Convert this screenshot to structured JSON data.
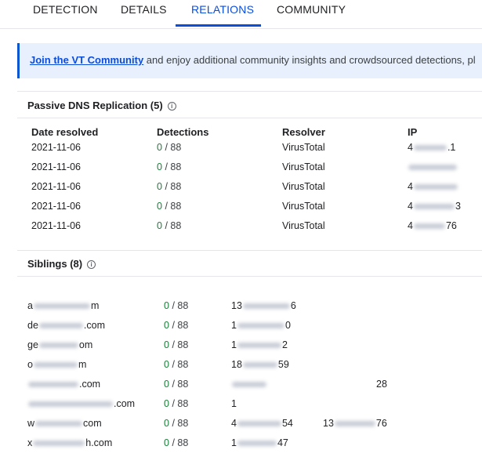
{
  "tabs": [
    {
      "label": "DETECTION",
      "active": false
    },
    {
      "label": "DETAILS",
      "active": false
    },
    {
      "label": "RELATIONS",
      "active": true
    },
    {
      "label": "COMMUNITY",
      "active": false
    }
  ],
  "banner": {
    "link_text": "Join the VT Community",
    "text": " and enjoy additional community insights and crowdsourced detections, pl"
  },
  "passive_dns": {
    "title": "Passive DNS Replication",
    "count": "(5)",
    "columns": [
      "Date resolved",
      "Detections",
      "Resolver",
      "IP"
    ],
    "rows": [
      {
        "date": "2021-11-06",
        "det_pos": "0",
        "det_total": "/ 88",
        "resolver": "VirusTotal",
        "ip_start": "4",
        "ip_end": ".1"
      },
      {
        "date": "2021-11-06",
        "det_pos": "0",
        "det_total": "/ 88",
        "resolver": "VirusTotal",
        "ip_start": "",
        "ip_end": ""
      },
      {
        "date": "2021-11-06",
        "det_pos": "0",
        "det_total": "/ 88",
        "resolver": "VirusTotal",
        "ip_start": "4",
        "ip_end": ""
      },
      {
        "date": "2021-11-06",
        "det_pos": "0",
        "det_total": "/ 88",
        "resolver": "VirusTotal",
        "ip_start": "4",
        "ip_end": "3"
      },
      {
        "date": "2021-11-06",
        "det_pos": "0",
        "det_total": "/ 88",
        "resolver": "VirusTotal",
        "ip_start": "4",
        "ip_end": "76"
      }
    ]
  },
  "siblings": {
    "title": "Siblings",
    "count": "(8)",
    "rows": [
      {
        "dom_start": "a",
        "dom_end": "m",
        "det_pos": "0",
        "det_total": "/ 88",
        "c1_start": "13",
        "c1_end": "6",
        "c2_start": "",
        "c2_end": ""
      },
      {
        "dom_start": "de",
        "dom_end": ".com",
        "det_pos": "0",
        "det_total": "/ 88",
        "c1_start": "1",
        "c1_end": "0",
        "c2_start": "",
        "c2_end": ""
      },
      {
        "dom_start": "ge",
        "dom_end": "om",
        "det_pos": "0",
        "det_total": "/ 88",
        "c1_start": "1",
        "c1_end": "2",
        "c2_start": "",
        "c2_end": ""
      },
      {
        "dom_start": "o",
        "dom_end": "m",
        "det_pos": "0",
        "det_total": "/ 88",
        "c1_start": "18",
        "c1_end": "59",
        "c2_start": "",
        "c2_end": ""
      },
      {
        "dom_start": "",
        "dom_end": ".com",
        "det_pos": "0",
        "det_total": "/ 88",
        "c1_start": "",
        "c1_end": "",
        "c2_start": "",
        "c2_end": "28"
      },
      {
        "dom_start": "",
        "dom_end": ".com",
        "det_pos": "0",
        "det_total": "/ 88",
        "c1_start": "1",
        "c1_end": "",
        "c2_start": "",
        "c2_end": ""
      },
      {
        "dom_start": "w",
        "dom_end": "com",
        "det_pos": "0",
        "det_total": "/ 88",
        "c1_start": "4",
        "c1_end": "54",
        "c2_start": "13",
        "c2_end": "76"
      },
      {
        "dom_start": "x",
        "dom_end": "h.com",
        "det_pos": "0",
        "det_total": "/ 88",
        "c1_start": "1",
        "c1_end": "47",
        "c2_start": "",
        "c2_end": ""
      }
    ]
  }
}
